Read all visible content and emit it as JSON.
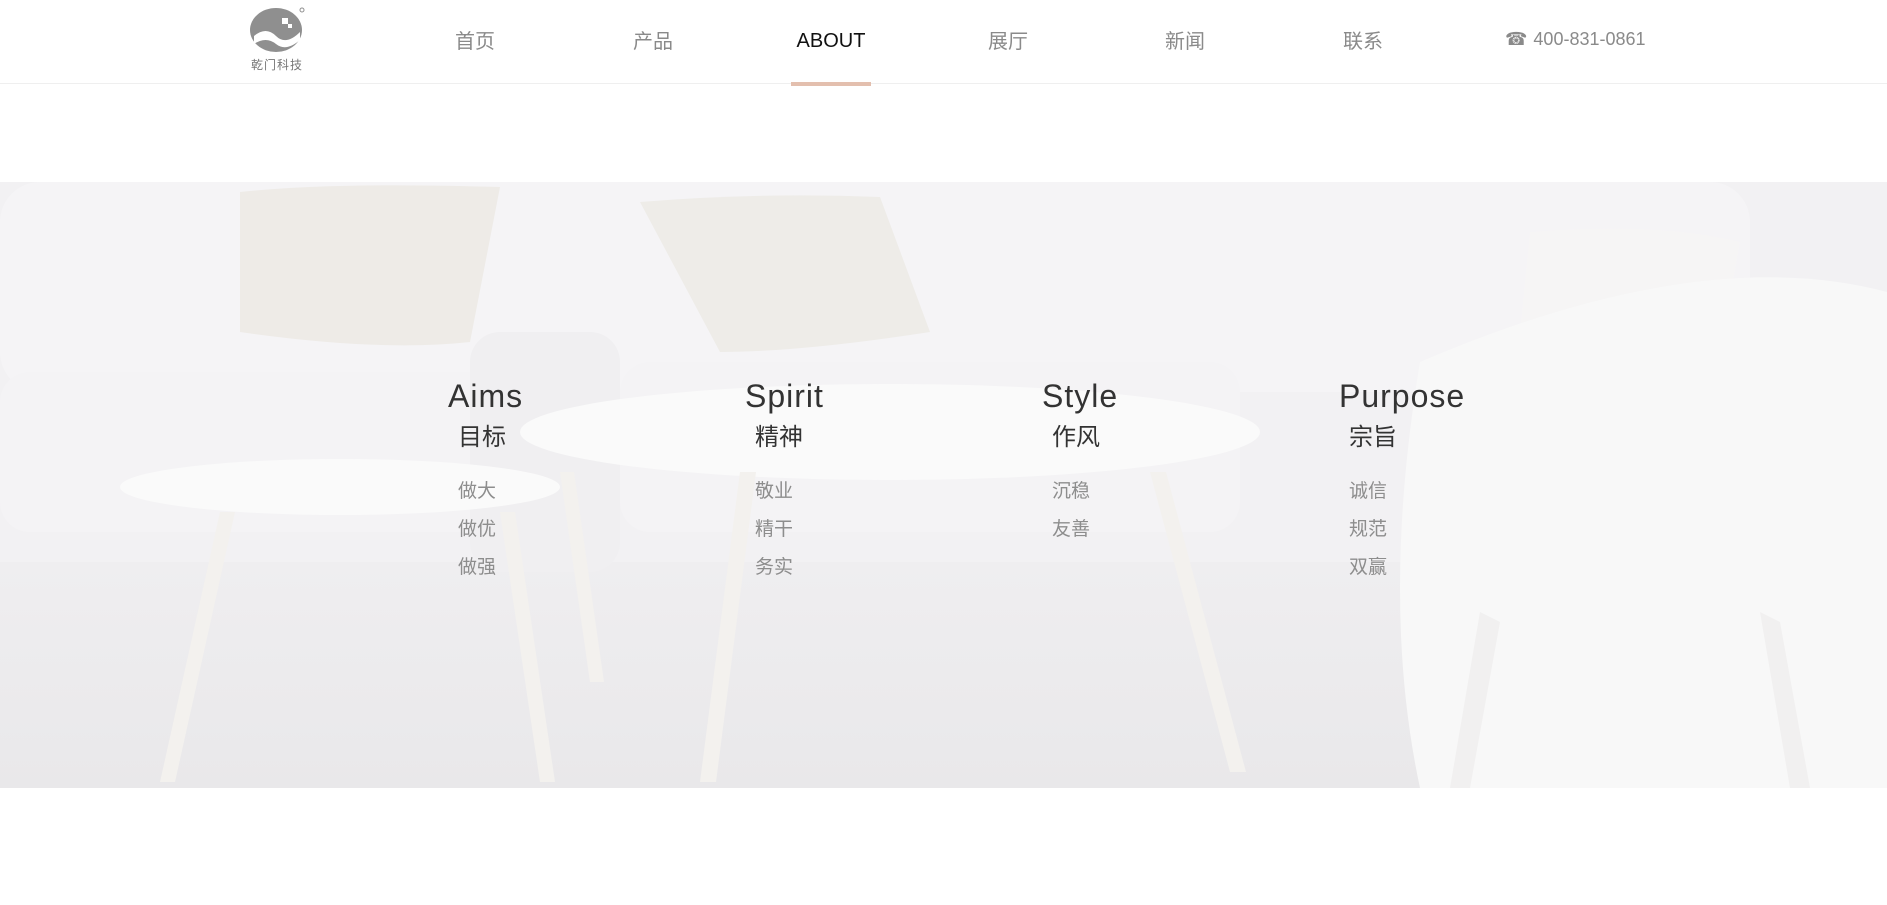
{
  "brand": {
    "logo_text": "乾门科技",
    "logo_icon": "company-logo-icon"
  },
  "nav": {
    "items": [
      {
        "label": "首页",
        "active": false
      },
      {
        "label": "产品",
        "active": false
      },
      {
        "label": "ABOUT",
        "active": true
      },
      {
        "label": "展厅",
        "active": false
      },
      {
        "label": "新闻",
        "active": false
      },
      {
        "label": "联系",
        "active": false
      }
    ],
    "phone": {
      "icon": "phone-icon",
      "number": "400-831-0861"
    },
    "active_indicator_color": "#e3bfae"
  },
  "values": [
    {
      "en": "Aims",
      "zh": "目标",
      "items": [
        "做大",
        "做优",
        "做强"
      ]
    },
    {
      "en": "Spirit",
      "zh": "精神",
      "items": [
        "敬业",
        "精干",
        "务实"
      ]
    },
    {
      "en": "Style",
      "zh": "作风",
      "items": [
        "沉稳",
        "友善"
      ]
    },
    {
      "en": "Purpose",
      "zh": "宗旨",
      "items": [
        "诚信",
        "规范",
        "双赢"
      ]
    }
  ]
}
